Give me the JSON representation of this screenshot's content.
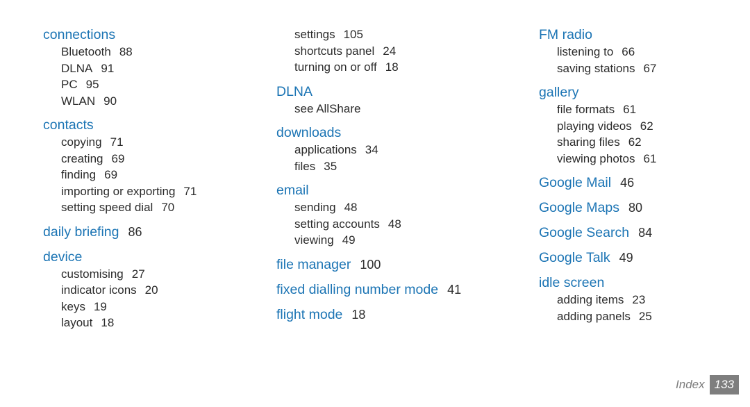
{
  "document": {
    "type": "index-page",
    "footer_label": "Index",
    "footer_page_number": "133",
    "heading_color": "#1b74b4",
    "body_color": "#2b2b2b",
    "page_badge_color": "#7e7e7e",
    "background_color": "#ffffff"
  },
  "columns": [
    {
      "id": "column-1",
      "groups": [
        {
          "heading": "connections",
          "heading_page": "",
          "entries": [
            {
              "label": "Bluetooth",
              "page": "88"
            },
            {
              "label": "DLNA",
              "page": "91"
            },
            {
              "label": "PC",
              "page": "95"
            },
            {
              "label": "WLAN",
              "page": "90"
            }
          ]
        },
        {
          "heading": "contacts",
          "heading_page": "",
          "entries": [
            {
              "label": "copying",
              "page": "71"
            },
            {
              "label": "creating",
              "page": "69"
            },
            {
              "label": "finding",
              "page": "69"
            },
            {
              "label": "importing or exporting",
              "page": "71"
            },
            {
              "label": "setting speed dial",
              "page": "70"
            }
          ]
        },
        {
          "heading": "daily briefing",
          "heading_page": "86",
          "entries": []
        },
        {
          "heading": "device",
          "heading_page": "",
          "entries": [
            {
              "label": "customising",
              "page": "27"
            },
            {
              "label": "indicator icons",
              "page": "20"
            },
            {
              "label": "keys",
              "page": "19"
            },
            {
              "label": "layout",
              "page": "18"
            }
          ]
        }
      ]
    },
    {
      "id": "column-2",
      "groups": [
        {
          "heading": "",
          "heading_page": "",
          "entries": [
            {
              "label": "settings",
              "page": "105"
            },
            {
              "label": "shortcuts panel",
              "page": "24"
            },
            {
              "label": "turning on or off",
              "page": "18"
            }
          ]
        },
        {
          "heading": "DLNA",
          "heading_page": "",
          "entries": [
            {
              "label": "see AllShare",
              "page": ""
            }
          ]
        },
        {
          "heading": "downloads",
          "heading_page": "",
          "entries": [
            {
              "label": "applications",
              "page": "34"
            },
            {
              "label": "files",
              "page": "35"
            }
          ]
        },
        {
          "heading": "email",
          "heading_page": "",
          "entries": [
            {
              "label": "sending",
              "page": "48"
            },
            {
              "label": "setting accounts",
              "page": "48"
            },
            {
              "label": "viewing",
              "page": "49"
            }
          ]
        },
        {
          "heading": "file manager",
          "heading_page": "100",
          "entries": []
        },
        {
          "heading": "fixed dialling number mode",
          "heading_page": "41",
          "entries": []
        },
        {
          "heading": "flight mode",
          "heading_page": "18",
          "entries": []
        }
      ]
    },
    {
      "id": "column-3",
      "groups": [
        {
          "heading": "FM radio",
          "heading_page": "",
          "entries": [
            {
              "label": "listening to",
              "page": "66"
            },
            {
              "label": "saving stations",
              "page": "67"
            }
          ]
        },
        {
          "heading": "gallery",
          "heading_page": "",
          "entries": [
            {
              "label": "file formats",
              "page": "61"
            },
            {
              "label": "playing videos",
              "page": "62"
            },
            {
              "label": "sharing files",
              "page": "62"
            },
            {
              "label": "viewing photos",
              "page": "61"
            }
          ]
        },
        {
          "heading": "Google Mail",
          "heading_page": "46",
          "entries": []
        },
        {
          "heading": "Google Maps",
          "heading_page": "80",
          "entries": []
        },
        {
          "heading": "Google Search",
          "heading_page": "84",
          "entries": []
        },
        {
          "heading": "Google Talk",
          "heading_page": "49",
          "entries": []
        },
        {
          "heading": "idle screen",
          "heading_page": "",
          "entries": [
            {
              "label": "adding items",
              "page": "23"
            },
            {
              "label": "adding panels",
              "page": "25"
            }
          ]
        }
      ]
    }
  ]
}
